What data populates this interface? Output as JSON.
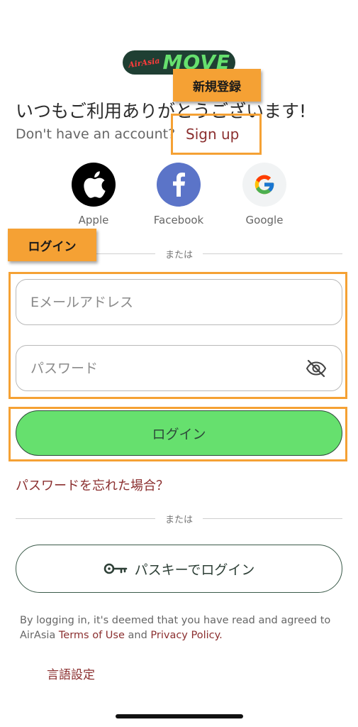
{
  "logo": {
    "brand_small": "AirAsia",
    "brand_large": "MOVE"
  },
  "header": {
    "welcome": "いつもご利用ありがとうございます!",
    "no_account": "Don't have an account?",
    "sign_up": "Sign up"
  },
  "annotations": {
    "signup_callout": "新規登録",
    "login_callout": "ログイン",
    "highlight_color": "#f5a134"
  },
  "social": [
    {
      "label": "Apple",
      "icon": "apple-icon"
    },
    {
      "label": "Facebook",
      "icon": "facebook-icon"
    },
    {
      "label": "Google",
      "icon": "google-icon"
    }
  ],
  "divider_text": "または",
  "form": {
    "email_placeholder": "Eメールアドレス",
    "email_value": "",
    "password_placeholder": "パスワード",
    "password_value": "",
    "login_label": "ログイン",
    "forgot_password": "パスワードを忘れた場合？"
  },
  "passkey": {
    "label": "パスキーでログイン",
    "icon": "key-icon"
  },
  "terms": {
    "prefix": "By logging in, it's deemed that you have read and agreed to AirAsia",
    "terms_link": "Terms of Use",
    "and": "and",
    "privacy_link": "Privacy Policy",
    "suffix": "."
  },
  "language_settings": "言語設定",
  "colors": {
    "accent_green": "#66e06e",
    "link_red": "#8b2f2f",
    "dark_green": "#2d4a3a"
  }
}
